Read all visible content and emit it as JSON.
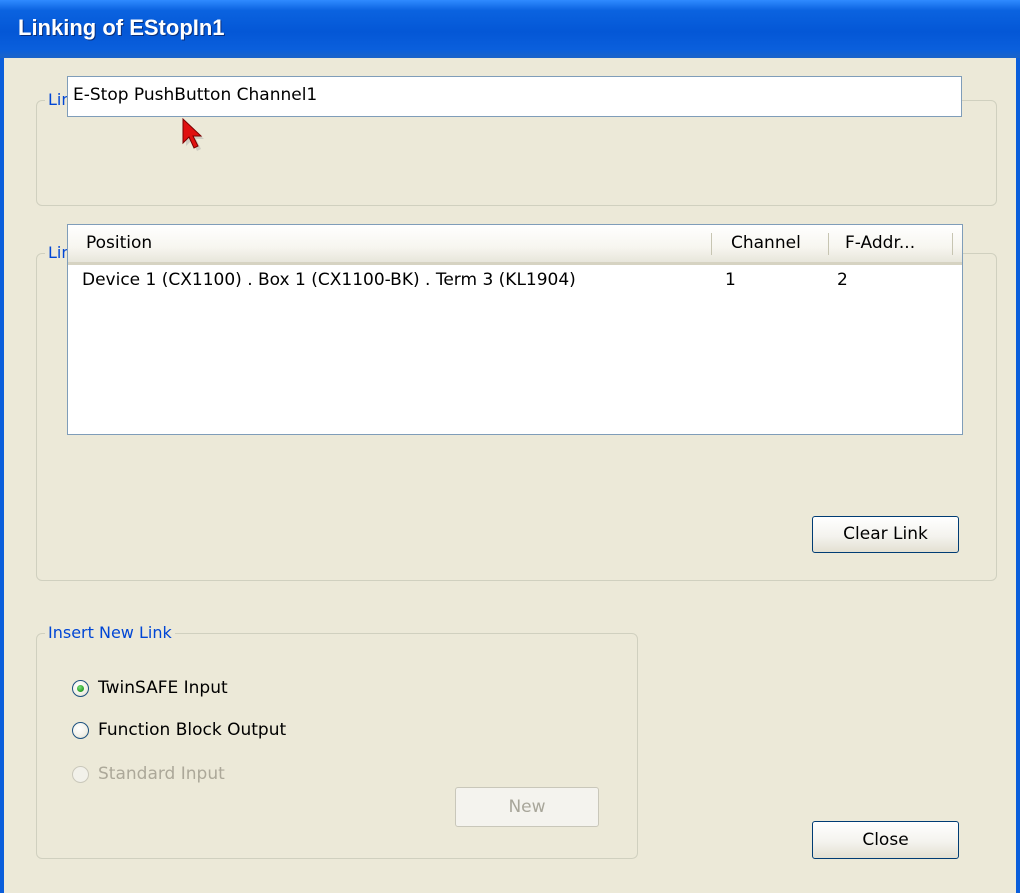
{
  "window": {
    "title": "Linking of EStopIn1"
  },
  "link_alias": {
    "legend": "Link Alias",
    "value": "E-Stop PushButton Channel1"
  },
  "links": {
    "legend": "Links",
    "columns": [
      "Position",
      "Channel",
      "F-Addr..."
    ],
    "rows": [
      {
        "position": "Device 1 (CX1100) . Box 1 (CX1100-BK) . Term 3 (KL1904)",
        "channel": "1",
        "faddr": "2"
      }
    ],
    "clear_button": "Clear Link"
  },
  "insert_new_link": {
    "legend": "Insert New Link",
    "options": [
      {
        "label": "TwinSAFE Input",
        "checked": true,
        "enabled": true
      },
      {
        "label": "Function Block Output",
        "checked": false,
        "enabled": true
      },
      {
        "label": "Standard Input",
        "checked": false,
        "enabled": false
      }
    ],
    "new_button": "New"
  },
  "close_button": "Close",
  "icons": {
    "cursor": "mouse-pointer-icon"
  },
  "colors": {
    "titlebar": "#0457d6",
    "dialog_background": "#ece9d8",
    "groupbox_label": "#0046d5",
    "field_border": "#7f9db9",
    "cursor": "#e01010"
  }
}
